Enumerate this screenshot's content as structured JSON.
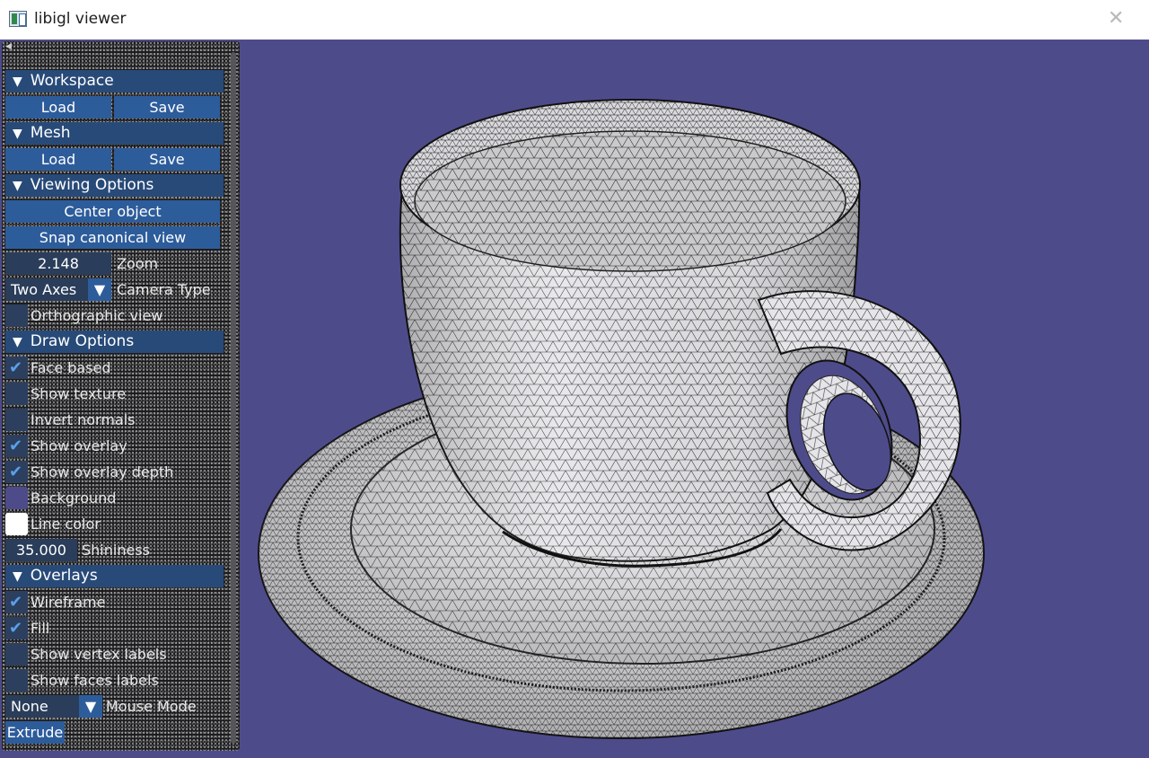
{
  "window": {
    "title": "libigl viewer",
    "close_icon": "close-icon"
  },
  "viewport": {
    "background_color": "#4e4b8b",
    "mesh_color": "#e9e9ec",
    "wire_color": "#222222"
  },
  "panel": {
    "workspace": {
      "header": "Workspace",
      "load": "Load",
      "save": "Save"
    },
    "mesh": {
      "header": "Mesh",
      "load": "Load",
      "save": "Save"
    },
    "viewing": {
      "header": "Viewing Options",
      "center": "Center object",
      "snap": "Snap canonical view",
      "zoom_value": "2.148",
      "zoom_label": "Zoom",
      "camera_value": "Two Axes",
      "camera_label": "Camera Type",
      "ortho_label": "Orthographic view",
      "ortho_checked": false
    },
    "draw": {
      "header": "Draw Options",
      "face_based": "Face based",
      "show_texture": "Show texture",
      "invert_normals": "Invert normals",
      "show_overlay": "Show overlay",
      "show_overlay_depth": "Show overlay depth",
      "background": "Background",
      "background_color": "#4e4b8b",
      "line_color": "Line color",
      "line_color_value": "#ffffff",
      "shininess_value": "35.000",
      "shininess_label": "Shininess",
      "checked": {
        "face_based": true,
        "show_texture": false,
        "invert_normals": false,
        "show_overlay": true,
        "show_overlay_depth": true
      }
    },
    "overlays": {
      "header": "Overlays",
      "wireframe": "Wireframe",
      "fill": "Fill",
      "vertex_labels": "Show vertex labels",
      "face_labels": "Show faces labels",
      "checked": {
        "wireframe": true,
        "fill": true,
        "vertex_labels": false,
        "face_labels": false
      }
    },
    "mouse": {
      "mode_value": "None",
      "mode_label": "Mouse Mode",
      "extrude": "Extrude"
    },
    "check_mark": "✔",
    "arrow": "▼"
  }
}
